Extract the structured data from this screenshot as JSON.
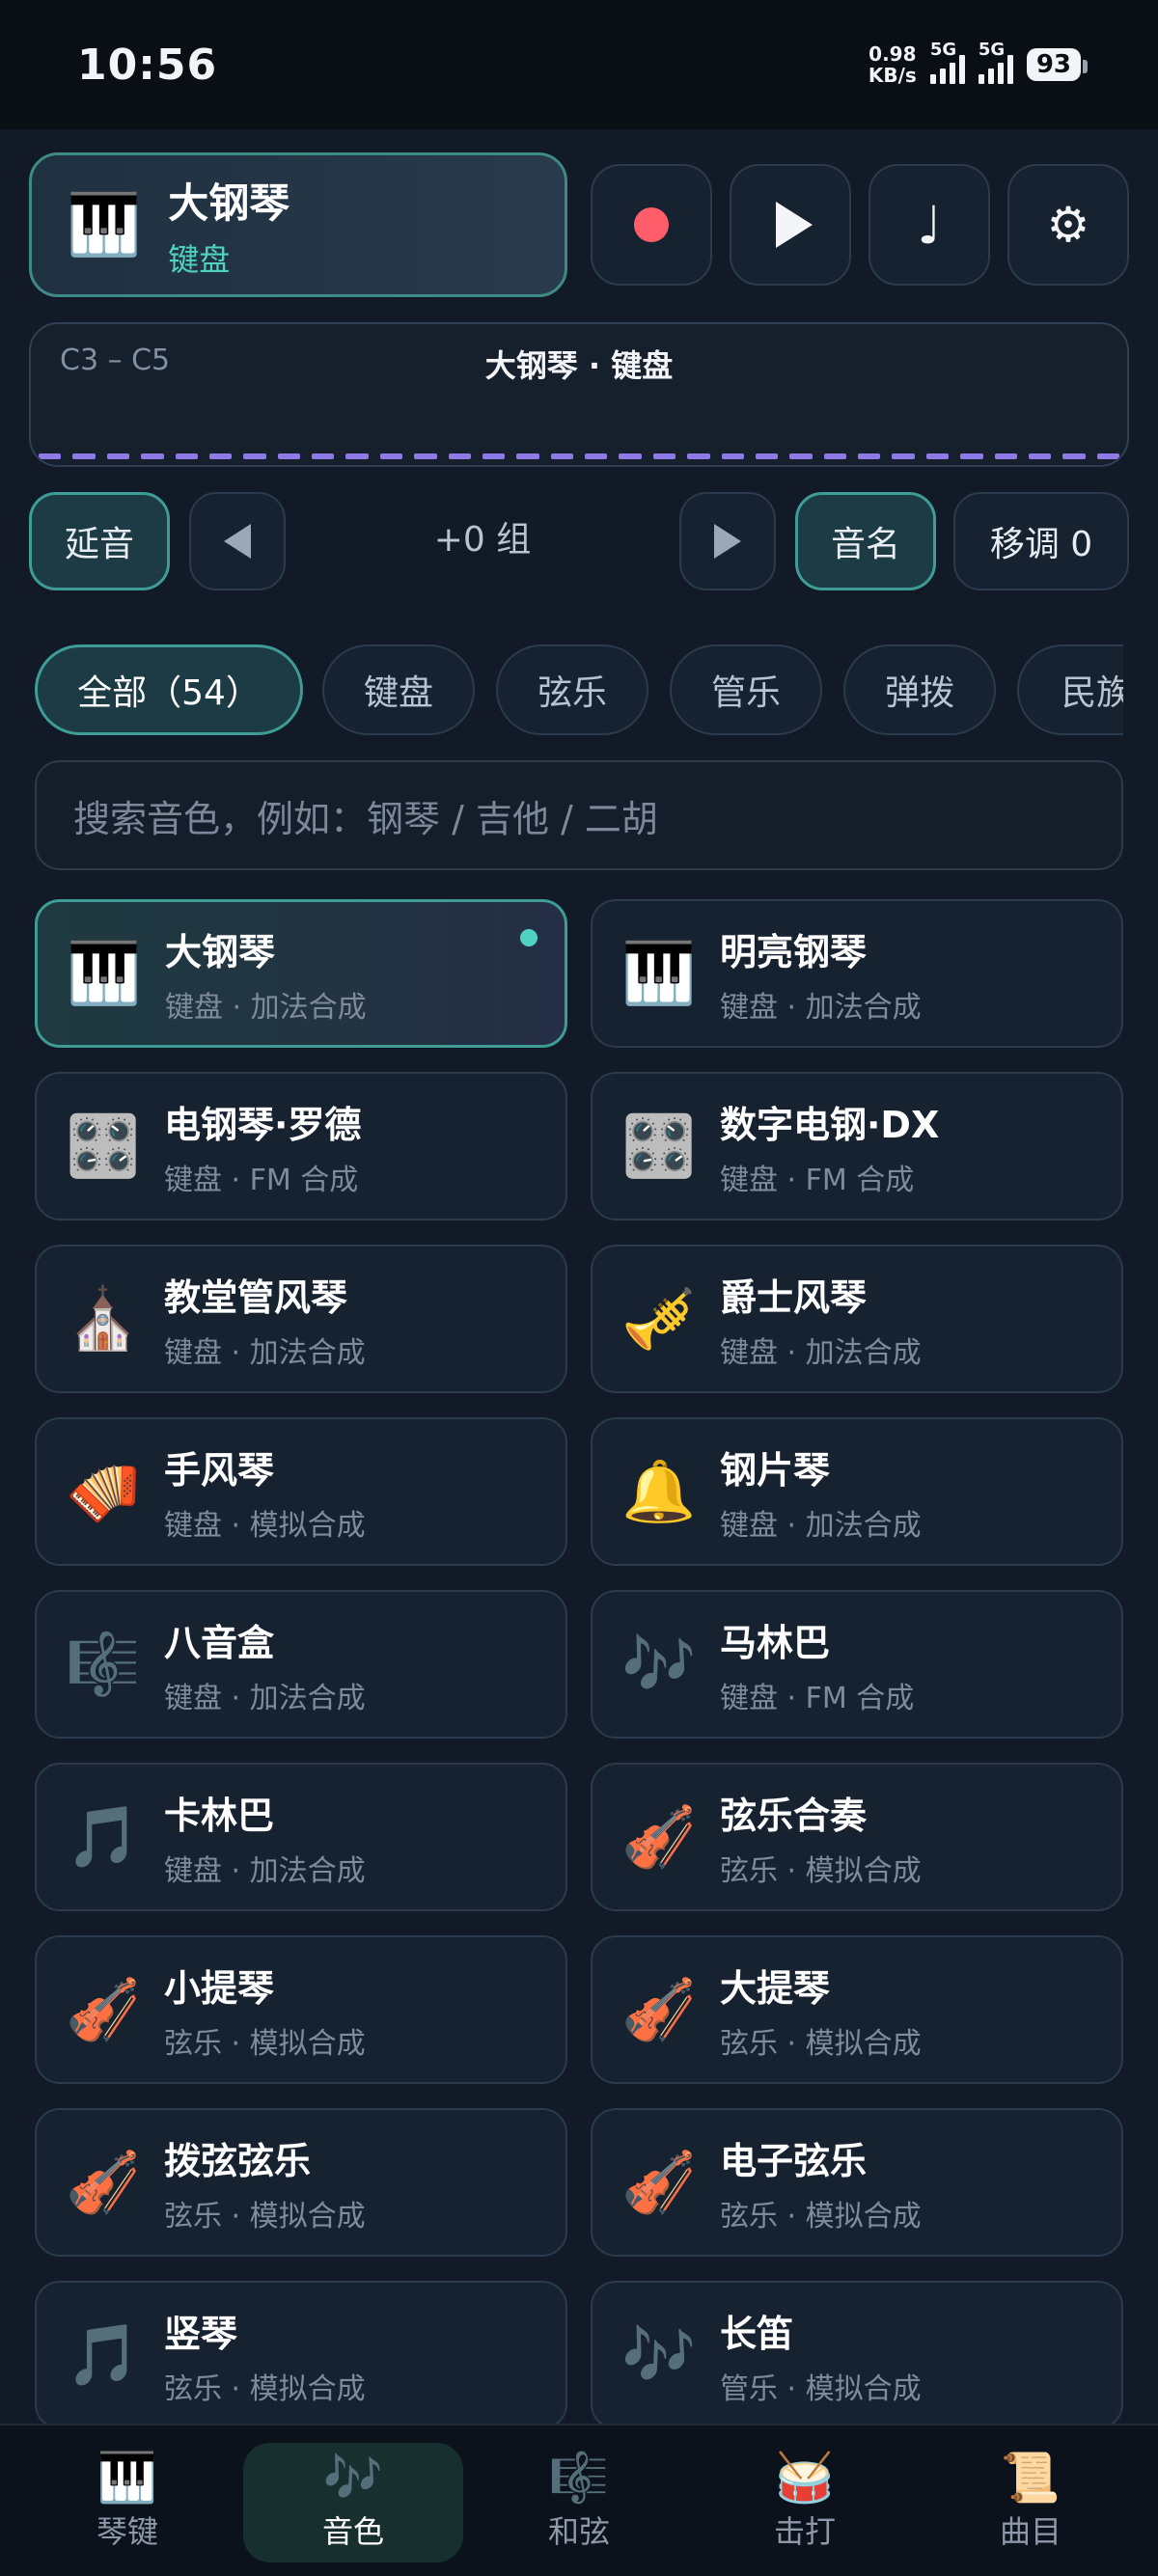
{
  "status_bar": {
    "time": "10:56",
    "net_speed_value": "0.98",
    "net_speed_unit": "KB/s",
    "sim1": "5G",
    "sim2": "5G",
    "battery": "93"
  },
  "current": {
    "icon": "🎹",
    "name": "大钢琴",
    "category": "键盘"
  },
  "controls": {
    "record_icon": "record-icon",
    "play_icon": "play-icon",
    "note_glyph": "♩",
    "settings_glyph": "⚙"
  },
  "keyboard_range": {
    "range": "C3 – C5",
    "title": "大钢琴 · 键盘"
  },
  "toolbar": {
    "sustain": "延音",
    "group": "+0 组",
    "note_names": "音名",
    "transpose": "移调 0"
  },
  "categories": [
    "全部（54）",
    "键盘",
    "弦乐",
    "管乐",
    "弹拨",
    "民族"
  ],
  "search": {
    "placeholder": "搜索音色，例如：钢琴 / 吉他 / 二胡"
  },
  "instruments": [
    {
      "icon": "🎹",
      "name": "大钢琴",
      "desc": "键盘 · 加法合成",
      "selected": true
    },
    {
      "icon": "🎹",
      "name": "明亮钢琴",
      "desc": "键盘 · 加法合成"
    },
    {
      "icon": "🎛️",
      "name": "电钢琴·罗德",
      "desc": "键盘 · FM 合成"
    },
    {
      "icon": "🎛️",
      "name": "数字电钢·DX",
      "desc": "键盘 · FM 合成"
    },
    {
      "icon": "⛪",
      "name": "教堂管风琴",
      "desc": "键盘 · 加法合成"
    },
    {
      "icon": "🎺",
      "name": "爵士风琴",
      "desc": "键盘 · 加法合成"
    },
    {
      "icon": "🪗",
      "name": "手风琴",
      "desc": "键盘 · 模拟合成"
    },
    {
      "icon": "🔔",
      "name": "钢片琴",
      "desc": "键盘 · 加法合成"
    },
    {
      "icon": "🎼",
      "name": "八音盒",
      "desc": "键盘 · 加法合成"
    },
    {
      "icon": "🎶",
      "name": "马林巴",
      "desc": "键盘 · FM 合成"
    },
    {
      "icon": "🎵",
      "name": "卡林巴",
      "desc": "键盘 · 加法合成"
    },
    {
      "icon": "🎻",
      "name": "弦乐合奏",
      "desc": "弦乐 · 模拟合成"
    },
    {
      "icon": "🎻",
      "name": "小提琴",
      "desc": "弦乐 · 模拟合成"
    },
    {
      "icon": "🎻",
      "name": "大提琴",
      "desc": "弦乐 · 模拟合成"
    },
    {
      "icon": "🎻",
      "name": "拨弦弦乐",
      "desc": "弦乐 · 模拟合成"
    },
    {
      "icon": "🎻",
      "name": "电子弦乐",
      "desc": "弦乐 · 模拟合成"
    },
    {
      "icon": "🎵",
      "name": "竖琴",
      "desc": "弦乐 · 模拟合成"
    },
    {
      "icon": "🎶",
      "name": "长笛",
      "desc": "管乐 · 模拟合成"
    }
  ],
  "bottom_nav": [
    {
      "icon": "🎹",
      "label": "琴键"
    },
    {
      "icon": "🎶",
      "label": "音色",
      "active": true
    },
    {
      "icon": "🎼",
      "label": "和弦"
    },
    {
      "icon": "🥁",
      "label": "击打"
    },
    {
      "icon": "📜",
      "label": "曲目"
    }
  ]
}
